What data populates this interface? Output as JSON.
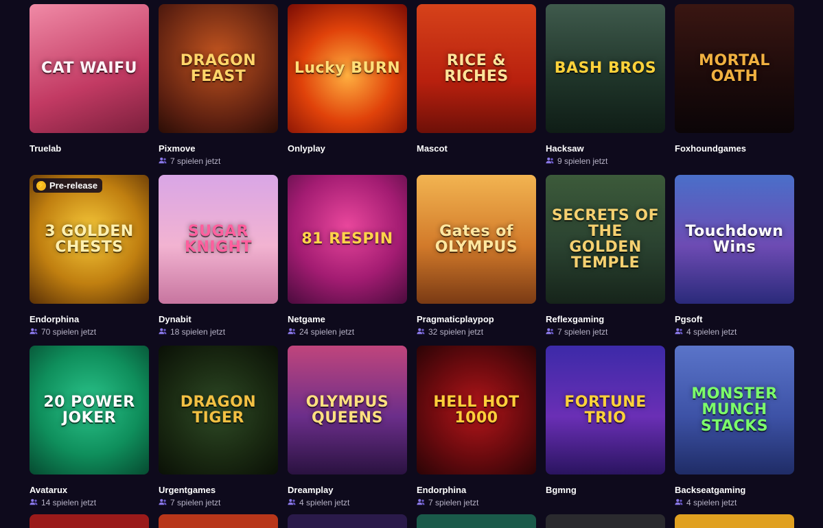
{
  "games": [
    {
      "title": "CAT WAIFU",
      "provider": "Truelab",
      "players": "",
      "bg": "linear-gradient(160deg,#f08aa6,#c23a63 60%,#7a1f3c)",
      "fg": "#fff4f8"
    },
    {
      "title": "DRAGON FEAST",
      "provider": "Pixmove",
      "players": "7 spielen jetzt",
      "bg": "radial-gradient(circle at 50% 40%,#c2541f,#5b1f10 70%,#2a0d06)",
      "fg": "#ffd56a"
    },
    {
      "title": "Lucky BURN",
      "provider": "Onlyplay",
      "players": "",
      "bg": "radial-gradient(circle at 50% 55%,#ffb040,#e0420a 50%,#7a0c04)",
      "fg": "#ffe07a"
    },
    {
      "title": "RICE & RICHES",
      "provider": "Mascot",
      "players": "",
      "bg": "linear-gradient(180deg,#d6421a,#b8200e 60%,#6e1008)",
      "fg": "#ffe49a"
    },
    {
      "title": "BASH BROS",
      "provider": "Hacksaw",
      "players": "9 spielen jetzt",
      "bg": "linear-gradient(180deg,#3f5a4c,#1e3328 60%,#0f1d16)",
      "fg": "#ffd23a"
    },
    {
      "title": "MORTAL OATH",
      "provider": "Foxhoundgames",
      "players": "",
      "bg": "linear-gradient(180deg,#3a1612,#1b0a0a 60%,#0b0507)",
      "fg": "#f0b040"
    },
    {
      "title": "3 GOLDEN CHESTS",
      "provider": "Endorphina",
      "players": "70 spielen jetzt",
      "bg": "radial-gradient(circle at 50% 45%,#f6c93a,#c07f10 55%,#5a3006)",
      "fg": "#fff0b0",
      "badge": "Pre-release"
    },
    {
      "title": "SUGAR KNIGHT",
      "provider": "Dynabit",
      "players": "18 spielen jetzt",
      "bg": "linear-gradient(180deg,#d9a6e6,#f2b3d1 55%,#c7759f)",
      "fg": "#ff5f9e"
    },
    {
      "title": "81 RESPIN",
      "provider": "Netgame",
      "players": "24 spielen jetzt",
      "bg": "radial-gradient(circle at 50% 40%,#e9479c,#a31c72 55%,#4a0b3d)",
      "fg": "#ffd34a"
    },
    {
      "title": "Gates of OLYMPUS",
      "provider": "Pragmaticplaypop",
      "players": "32 spielen jetzt",
      "bg": "linear-gradient(180deg,#f2b451,#d27a2a 55%,#7a3a14)",
      "fg": "#ffe7a0"
    },
    {
      "title": "SECRETS OF THE GOLDEN TEMPLE",
      "provider": "Reflexgaming",
      "players": "7 spielen jetzt",
      "bg": "linear-gradient(180deg,#3c5a3a,#2a4230 55%,#16241a)",
      "fg": "#f5d070"
    },
    {
      "title": "Touchdown Wins",
      "provider": "Pgsoft",
      "players": "4 spielen jetzt",
      "bg": "linear-gradient(180deg,#4a6fc9,#6d4bb3 55%,#2a2a7a)",
      "fg": "#ffffff"
    },
    {
      "title": "20 POWER JOKER",
      "provider": "Avatarux",
      "players": "14 spielen jetzt",
      "bg": "radial-gradient(circle at 50% 45%,#2bc38a,#0f8f5c 55%,#064a30)",
      "fg": "#ffffff"
    },
    {
      "title": "DRAGON TIGER",
      "provider": "Urgentgames",
      "players": "7 spielen jetzt",
      "bg": "radial-gradient(circle at 50% 50%,#2e4a26,#1a2a12 55%,#0a1006)",
      "fg": "#f2c043"
    },
    {
      "title": "OLYMPUS QUEENS",
      "provider": "Dreamplay",
      "players": "4 spielen jetzt",
      "bg": "linear-gradient(180deg,#c0457c,#6b2e8a 55%,#2a1240)",
      "fg": "#ffe080"
    },
    {
      "title": "HELL HOT 1000",
      "provider": "Endorphina",
      "players": "7 spielen jetzt",
      "bg": "radial-gradient(circle at 50% 50%,#b3161a,#6a0a0e 55%,#2a0406)",
      "fg": "#ffcf3a"
    },
    {
      "title": "FORTUNE TRIO",
      "provider": "Bgmng",
      "players": "",
      "bg": "linear-gradient(180deg,#3c2aa8,#6a2fb5 55%,#2a1460)",
      "fg": "#ffd23a"
    },
    {
      "title": "MONSTER MUNCH STACKS",
      "provider": "Backseatgaming",
      "players": "4 spielen jetzt",
      "bg": "linear-gradient(180deg,#5a74c9,#3d52a6 55%,#1f2c66)",
      "fg": "#7cff6a"
    }
  ],
  "peek": [
    {
      "bg": "#9a1a1a"
    },
    {
      "bg": "#b8361a"
    },
    {
      "bg": "#2a1a4a"
    },
    {
      "bg": "#1a5a4a"
    },
    {
      "bg": "#2a2a2e"
    },
    {
      "bg": "#e0a020"
    }
  ]
}
